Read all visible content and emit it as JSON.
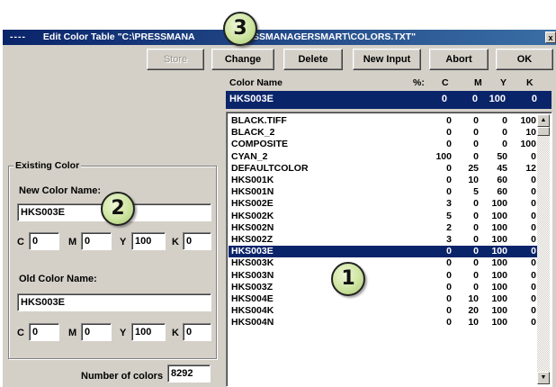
{
  "window": {
    "system_menu": "----",
    "title": "Edit Color Table  \"C:\\PRESSMANA",
    "title_tail": "SSMANAGERSMART\\COLORS.TXT\"",
    "close_glyph": "x"
  },
  "toolbar": {
    "store": "Store",
    "change": "Change",
    "delete": "Delete",
    "new_input": "New Input",
    "abort": "Abort",
    "ok": "OK"
  },
  "columns": {
    "name": "Color Name",
    "pct": "%:",
    "c": "C",
    "m": "M",
    "y": "Y",
    "k": "K"
  },
  "selected": {
    "name": "HKS003E",
    "c": "0",
    "m": "0",
    "y": "100",
    "k": "0"
  },
  "list": [
    {
      "name": "BLACK.TIFF",
      "c": "0",
      "m": "0",
      "y": "0",
      "k": "100"
    },
    {
      "name": "BLACK_2",
      "c": "0",
      "m": "0",
      "y": "0",
      "k": "10"
    },
    {
      "name": "COMPOSITE",
      "c": "0",
      "m": "0",
      "y": "0",
      "k": "100"
    },
    {
      "name": "CYAN_2",
      "c": "100",
      "m": "0",
      "y": "50",
      "k": "0"
    },
    {
      "name": "DEFAULTCOLOR",
      "c": "0",
      "m": "25",
      "y": "45",
      "k": "12"
    },
    {
      "name": "HKS001K",
      "c": "0",
      "m": "10",
      "y": "60",
      "k": "0"
    },
    {
      "name": "HKS001N",
      "c": "0",
      "m": "5",
      "y": "60",
      "k": "0"
    },
    {
      "name": "HKS002E",
      "c": "3",
      "m": "0",
      "y": "100",
      "k": "0"
    },
    {
      "name": "HKS002K",
      "c": "5",
      "m": "0",
      "y": "100",
      "k": "0"
    },
    {
      "name": "HKS002N",
      "c": "2",
      "m": "0",
      "y": "100",
      "k": "0"
    },
    {
      "name": "HKS002Z",
      "c": "3",
      "m": "0",
      "y": "100",
      "k": "0"
    },
    {
      "name": "HKS003E",
      "c": "0",
      "m": "0",
      "y": "100",
      "k": "0"
    },
    {
      "name": "HKS003K",
      "c": "0",
      "m": "0",
      "y": "100",
      "k": "0"
    },
    {
      "name": "HKS003N",
      "c": "0",
      "m": "0",
      "y": "100",
      "k": "0"
    },
    {
      "name": "HKS003Z",
      "c": "0",
      "m": "0",
      "y": "100",
      "k": "0"
    },
    {
      "name": "HKS004E",
      "c": "0",
      "m": "10",
      "y": "100",
      "k": "0"
    },
    {
      "name": "HKS004K",
      "c": "0",
      "m": "20",
      "y": "100",
      "k": "0"
    },
    {
      "name": "HKS004N",
      "c": "0",
      "m": "10",
      "y": "100",
      "k": "0"
    }
  ],
  "existing": {
    "group_title": "Existing Color",
    "new_label": "New Color Name:",
    "new_name": "HKS003E",
    "new_c": "0",
    "new_m": "0",
    "new_y": "100",
    "new_k": "0",
    "old_label": "Old Color Name:",
    "old_name": "HKS003E",
    "old_c": "0",
    "old_m": "0",
    "old_y": "100",
    "old_k": "0",
    "c_label": "C",
    "m_label": "M",
    "y_label": "Y",
    "k_label": "K"
  },
  "footer": {
    "count_label": "Number of colors",
    "count": "8292"
  },
  "callouts": {
    "one": "1",
    "two": "2",
    "three": "3"
  },
  "colors": {
    "title_start": "#0a246a",
    "title_end": "#3a6ea5",
    "face": "#d4d0c8",
    "selection": "#0a246a",
    "badge": "#cde4a0"
  }
}
